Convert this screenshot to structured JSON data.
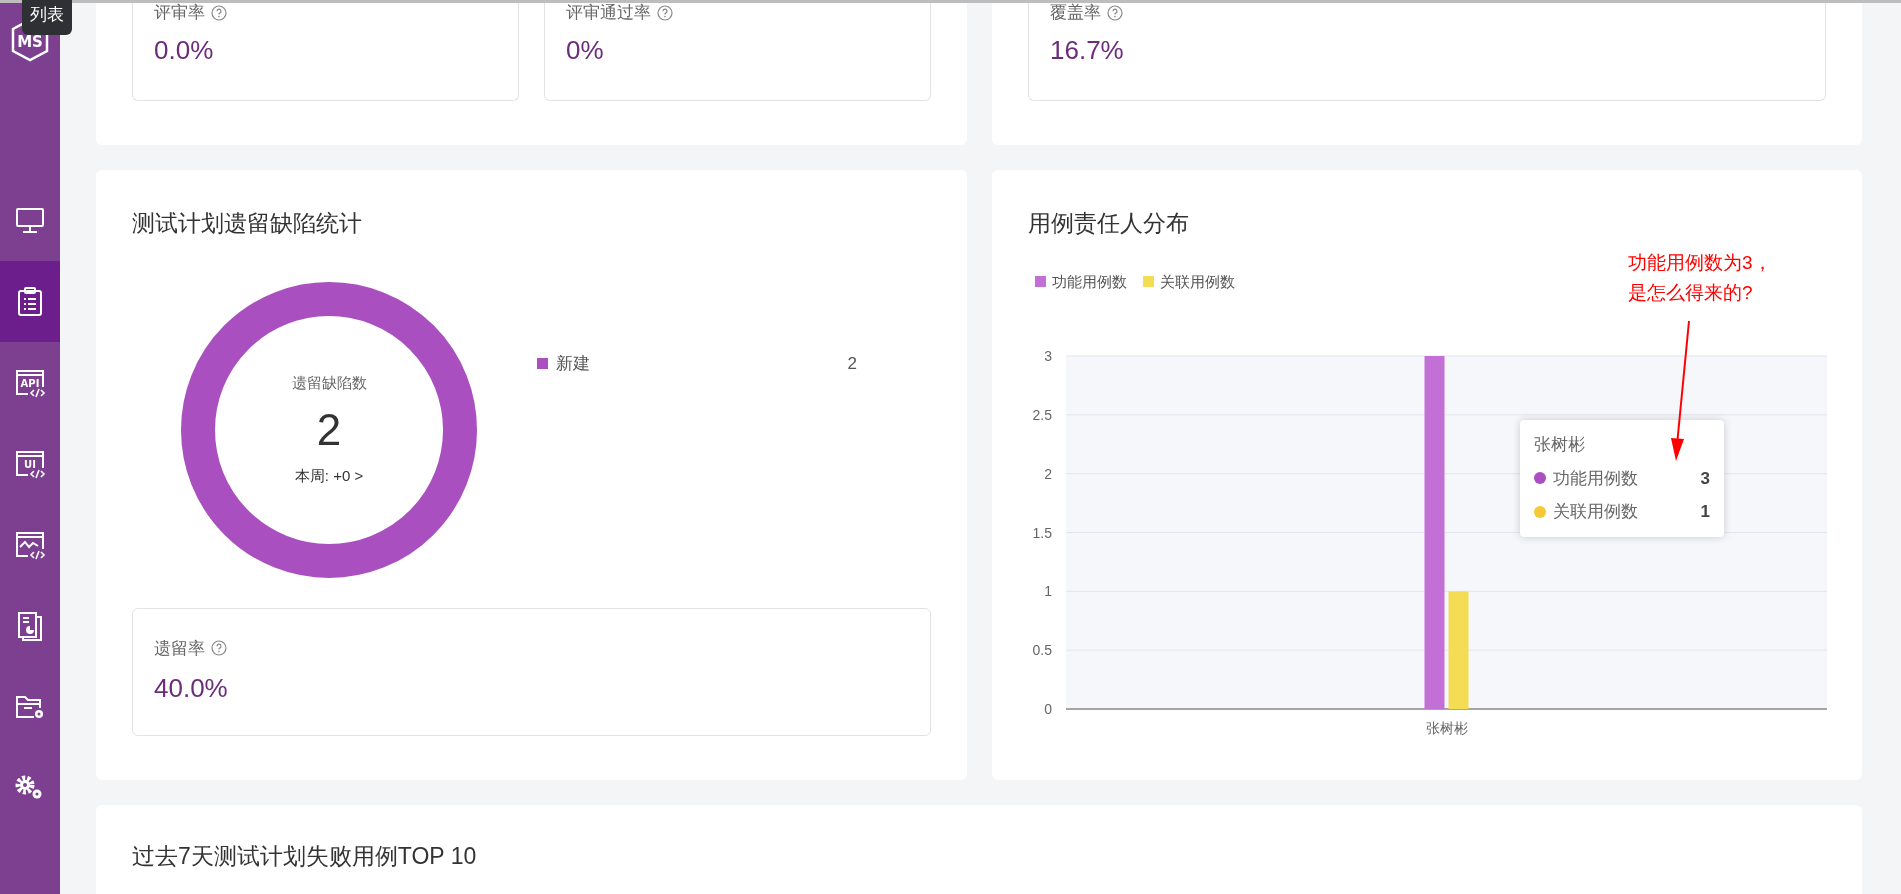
{
  "hover_tooltip": {
    "text": "列表"
  },
  "sidebar": {
    "logo_text": "MS",
    "items": [
      {
        "kind": "monitor",
        "selected": false
      },
      {
        "kind": "clipboard",
        "selected": true
      },
      {
        "kind": "code-window",
        "label": "API",
        "selected": false
      },
      {
        "kind": "code-window",
        "label": "UI",
        "selected": false
      },
      {
        "kind": "chart-window",
        "selected": false
      },
      {
        "kind": "report",
        "selected": false
      },
      {
        "kind": "folder-gear",
        "selected": false
      },
      {
        "kind": "gears",
        "selected": false
      }
    ]
  },
  "top_panels": [
    {
      "cards": [
        {
          "label": "评审率",
          "value": "0.0%"
        },
        {
          "label": "评审通过率",
          "value": "0%"
        }
      ]
    },
    {
      "cards": [
        {
          "label": "覆盖率",
          "value": "16.7%"
        }
      ]
    }
  ],
  "defect_panel": {
    "title": "测试计划遗留缺陷统计",
    "donut": {
      "center_label": "遗留缺陷数",
      "center_value": "2",
      "week_link": "本周: +0 >",
      "color": "#a94fbf"
    },
    "legend": [
      {
        "label": "新建",
        "value": "2",
        "color": "#a94fbf"
      }
    ],
    "rate_card": {
      "label": "遗留率",
      "value": "40.0%"
    }
  },
  "owner_panel": {
    "title": "用例责任人分布",
    "chart_data": {
      "type": "bar",
      "categories": [
        "张树彬"
      ],
      "series": [
        {
          "name": "功能用例数",
          "color": "#c270d6",
          "values": [
            3
          ]
        },
        {
          "name": "关联用例数",
          "color": "#f5dc55",
          "values": [
            1
          ]
        }
      ],
      "ylim": [
        0,
        3
      ],
      "yticks": [
        0,
        0.5,
        1,
        1.5,
        2,
        2.5,
        3
      ],
      "grid": true
    },
    "tooltip": {
      "title": "张树彬",
      "rows": [
        {
          "label": "功能用例数",
          "value": "3",
          "color": "#a94fbf"
        },
        {
          "label": "关联用例数",
          "value": "1",
          "color": "#f7c936"
        }
      ]
    },
    "annotation": {
      "lines": [
        "功能用例数为3，",
        "是怎么得来的?"
      ]
    }
  },
  "failed_panel": {
    "title": "过去7天测试计划失败用例TOP 10"
  }
}
